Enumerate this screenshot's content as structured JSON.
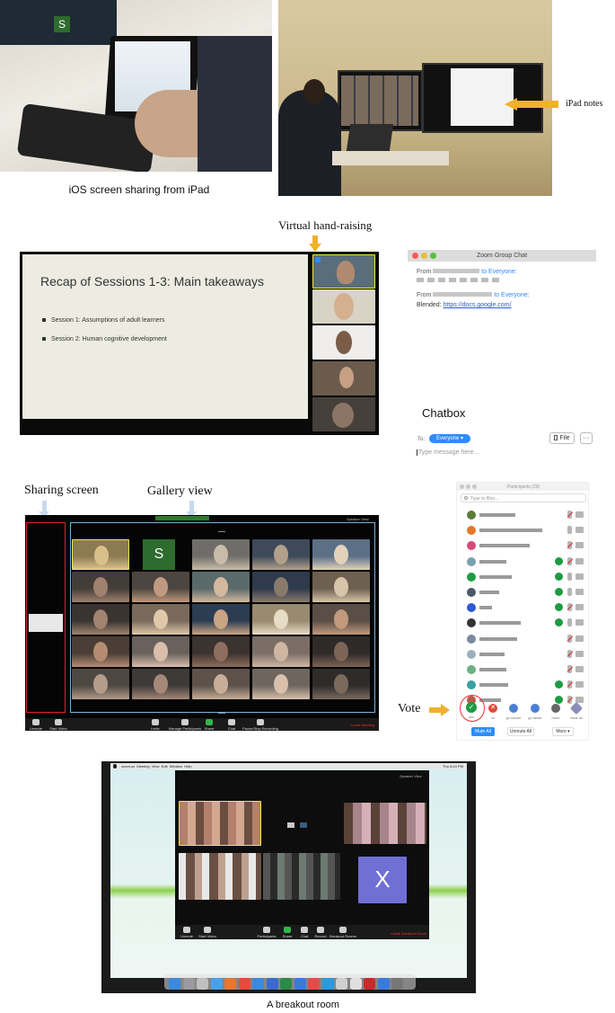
{
  "captions": {
    "ios_sharing": "iOS screen sharing from iPad",
    "ipad_notes": "iPad notes",
    "virtual_hand_raising": "Virtual hand-raising",
    "chatbox": "Chatbox",
    "sharing_screen": "Sharing screen",
    "gallery_view": "Gallery view",
    "vote": "Vote",
    "breakout_room": "A breakout room"
  },
  "slide": {
    "title": "Recap of Sessions 1-3: Main takeaways",
    "bullets": [
      "Session 1: Assumptions of adult learners",
      "Session 2: Human cognitive development"
    ]
  },
  "chat": {
    "window_title": "Zoom Group Chat",
    "msg1_from": "From",
    "msg1_to": "to Everyone:",
    "msg2_from": "From",
    "msg2_to": "to Everyone:",
    "msg2_text_label": "Blended:",
    "msg2_link": "https://docs.google.com/",
    "to_label": "To:",
    "recipient": "Everyone ▾",
    "file_button": "File",
    "more_button": "···",
    "input_placeholder": "Type message here..."
  },
  "gallery": {
    "tile_letter": "S",
    "speaker_view": "Speaker View",
    "toolbar": [
      "Unmute",
      "Start Video",
      "Invite",
      "Manage Participants",
      "Share",
      "Chat",
      "Pause/Stop Recording"
    ],
    "end_label": "Leave Meeting"
  },
  "participants": {
    "title": "Participants (29)",
    "search_placeholder": "Type to filter...",
    "reactions": [
      "yes",
      "no",
      "go slower",
      "go faster",
      "more",
      "clear all"
    ],
    "mute_all": "Mute All",
    "unmute_all": "Unmute All",
    "more": "More ▾"
  },
  "breakout": {
    "tile_letter": "X",
    "speaker_view": "Speaker View",
    "toolbar": [
      "Unmute",
      "Start Video",
      "Participants",
      "Share",
      "Chat",
      "Record",
      "Breakout Rooms"
    ],
    "leave_label": "Leave Breakout Room",
    "menu_items": [
      "zoom.us",
      "Meeting",
      "View",
      "Edit",
      "Window",
      "Help"
    ],
    "clock": "Thu 8:43 PM"
  },
  "colors": {
    "zoom_blue": "#2d8cff",
    "highlight_yellow": "#e9e94a",
    "arrow_orange": "#f0b12b",
    "green_tile": "#2e6b2e",
    "purple_tile": "#6f6fd6"
  },
  "icons": [
    "down-arrow-icon",
    "left-arrow-icon",
    "check-icon",
    "x-icon",
    "file-icon",
    "mic-icon",
    "video-icon",
    "search-icon"
  ]
}
